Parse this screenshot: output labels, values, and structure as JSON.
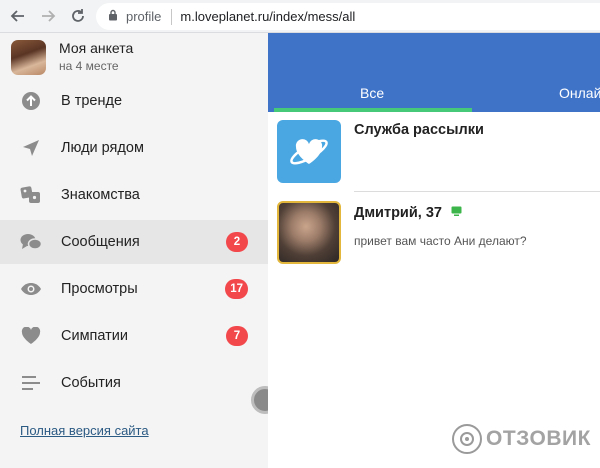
{
  "browser": {
    "url_prefix": "profile",
    "url": "m.loveplanet.ru/index/mess/all"
  },
  "profile": {
    "name": "Моя анкета",
    "subtitle": "на 4 месте"
  },
  "menu": [
    {
      "label": "В тренде",
      "icon": "trending-up-icon",
      "badge": ""
    },
    {
      "label": "Люди рядом",
      "icon": "location-arrow-icon",
      "badge": ""
    },
    {
      "label": "Знакомства",
      "icon": "cards-icon",
      "badge": ""
    },
    {
      "label": "Сообщения",
      "icon": "chat-bubbles-icon",
      "badge": "2",
      "active": true
    },
    {
      "label": "Просмотры",
      "icon": "eye-icon",
      "badge": "17"
    },
    {
      "label": "Симпатии",
      "icon": "heart-icon",
      "badge": "7"
    },
    {
      "label": "События",
      "icon": "events-lines-icon",
      "badge": ""
    }
  ],
  "full_version_link": "Полная версия сайта",
  "tabs": [
    {
      "label": "Все",
      "active": true
    },
    {
      "label": "Онлай"
    }
  ],
  "conversations": [
    {
      "name": "Служба рассылки",
      "preview": ""
    },
    {
      "name": "Дмитрий, 37",
      "preview": "привет вам часто Ани делают?",
      "online": true
    }
  ],
  "watermark": "ОТЗОВИК",
  "colors": {
    "header_blue": "#3f73c8",
    "tab_underline": "#47c97a",
    "badge_red": "#f2474b",
    "service_avatar": "#4aa7e2",
    "link": "#2b5a83"
  }
}
